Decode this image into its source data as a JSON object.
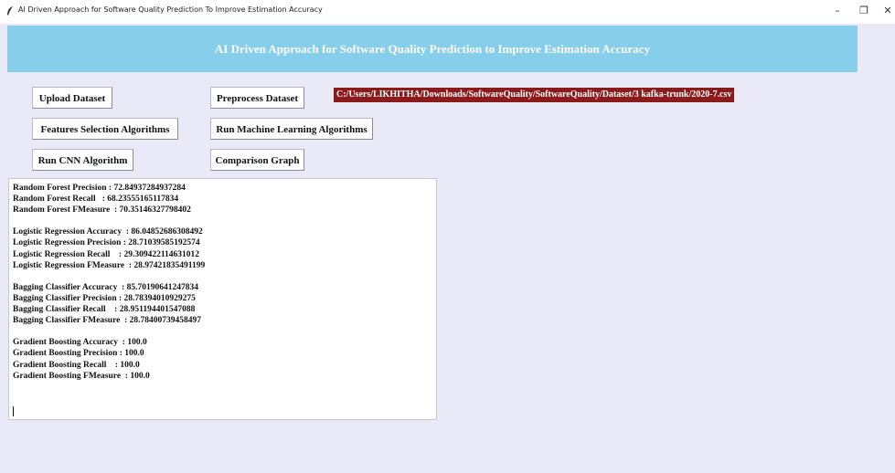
{
  "window": {
    "title": "AI Driven Approach for Software Quality Prediction To Improve Estimation Accuracy",
    "controls": {
      "minimize": "–",
      "maximize": "❐",
      "close": "✕"
    }
  },
  "header": {
    "title": "AI Driven Approach for Software Quality Prediction to Improve Estimation Accuracy"
  },
  "toolbar": {
    "upload_label": "Upload Dataset",
    "preprocess_label": "Preprocess Dataset",
    "features_label": "Features Selection Algorithms",
    "run_ml_label": "Run Machine Learning Algorithms",
    "run_cnn_label": "Run CNN Algorithm",
    "comparison_label": "Comparison Graph"
  },
  "dataset_path": "C:/Users/LIKHITHA/Downloads/SoftwareQuality/SoftwareQuality/Dataset/3 kafka-trunk/2020-7.csv",
  "output": {
    "text": "Random Forest Precision : 72.84937284937284\nRandom Forest Recall   : 68.23555165117834\nRandom Forest FMeasure  : 70.35146327798402\n\nLogistic Regression Accuracy  : 86.04852686308492\nLogistic Regression Precision : 28.71039585192574\nLogistic Regression Recall    : 29.309422114631012\nLogistic Regression FMeasure  : 28.97421835491199\n\nBagging Classifier Accuracy  : 85.70190641247834\nBagging Classifier Precision : 28.78394010929275\nBagging Classifier Recall    : 28.951194401547088\nBagging Classifier FMeasure  : 28.78400739458497\n\nGradient Boosting Accuracy  : 100.0\nGradient Boosting Precision : 100.0\nGradient Boosting Recall    : 100.0\nGradient Boosting FMeasure  : 100.0"
  },
  "icons": {
    "app": "feather-icon"
  },
  "colors": {
    "background": "#e9e9f8",
    "header_bg": "#87ceeb",
    "header_text": "#ffffff",
    "path_bg": "#8b1a1a",
    "path_text": "#ffffff"
  }
}
